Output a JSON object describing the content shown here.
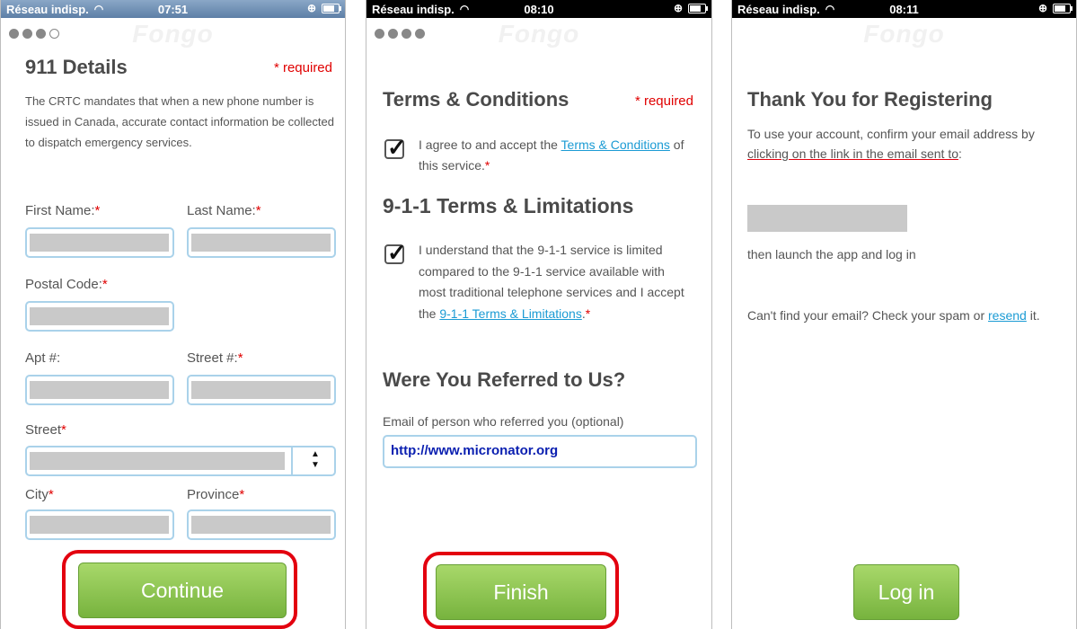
{
  "screen1": {
    "status": {
      "carrier": "Réseau indisp.",
      "time": "07:51"
    },
    "title": "911 Details",
    "required": "* required",
    "description": "The CRTC mandates that when a new phone number is issued in Canada, accurate contact information be collected to dispatch emergency services.",
    "fields": {
      "first_name": "First Name:",
      "last_name": "Last Name:",
      "postal_code": "Postal Code:",
      "apt": "Apt #:",
      "street_num": "Street #:",
      "street": "Street",
      "city": "City",
      "province": "Province"
    },
    "star": "*",
    "select_arrow": "▲▼",
    "continue_label": "Continue"
  },
  "screen2": {
    "status": {
      "carrier": "Réseau indisp.",
      "time": "08:10"
    },
    "terms_title": "Terms & Conditions",
    "required": "* required",
    "agree_prefix": "I agree to and accept the ",
    "agree_link": "Terms & Conditions",
    "agree_suffix": " of this service.",
    "star": "*",
    "limits_title": "9-1-1 Terms & Limitations",
    "understand_prefix": "I understand that the 9-1-1 service is limited compared to the 9-1-1 service available with most traditional telephone services and I accept the ",
    "understand_link": "9-1-1 Terms & Limitations",
    "understand_suffix": ".",
    "referred_title": "Were You Referred to Us?",
    "referred_label": "Email of person who referred you (optional)",
    "referred_value": "http://www.micronator.org",
    "finish_label": "Finish"
  },
  "screen3": {
    "status": {
      "carrier": "Réseau indisp.",
      "time": "08:11"
    },
    "title": "Thank You for Registering",
    "confirm_prefix": "To use your account, confirm your email address by ",
    "confirm_link": "clicking on the link in the email sent to",
    "confirm_suffix": ":",
    "launch": "then launch the app and log in",
    "cant_find": "Can't find your email? Check your spam or ",
    "resend": "resend",
    "resend_suffix": " it.",
    "login_label": "Log in"
  },
  "watermark": "Fongo",
  "colors": {
    "accent_green": "#8cc653",
    "link": "#1b9bd4",
    "required": "#e00000",
    "highlight_ring": "#e3000f"
  }
}
